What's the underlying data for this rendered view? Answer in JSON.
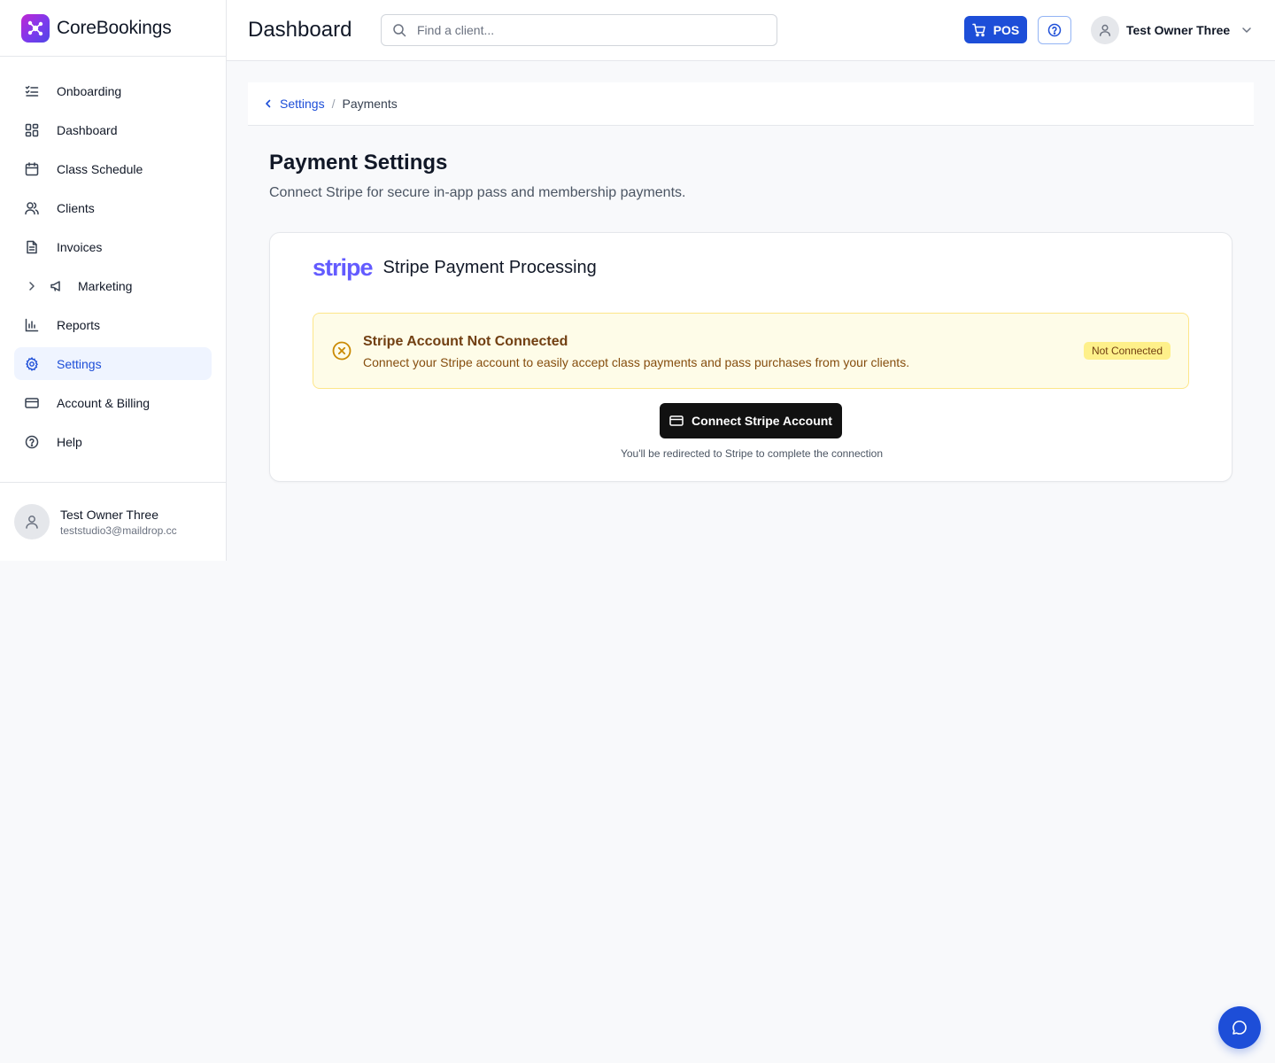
{
  "brand": {
    "name": "CoreBookings",
    "icon": "corebookings-logo-icon"
  },
  "sidebar": {
    "items": [
      {
        "label": "Onboarding",
        "icon": "checklist-icon"
      },
      {
        "label": "Dashboard",
        "icon": "dashboard-grid-icon"
      },
      {
        "label": "Class Schedule",
        "icon": "calendar-icon"
      },
      {
        "label": "Clients",
        "icon": "users-icon"
      },
      {
        "label": "Invoices",
        "icon": "invoice-icon"
      },
      {
        "label": "Marketing",
        "icon": "megaphone-icon"
      },
      {
        "label": "Reports",
        "icon": "bar-chart-icon"
      },
      {
        "label": "Settings",
        "icon": "gear-icon",
        "active": true
      },
      {
        "label": "Account & Billing",
        "icon": "credit-card-icon"
      },
      {
        "label": "Help",
        "icon": "help-circle-icon"
      }
    ],
    "user": {
      "name": "Test Owner Three",
      "email": "teststudio3@maildrop.cc"
    }
  },
  "header": {
    "title": "Dashboard",
    "search_placeholder": "Find a client...",
    "pos_label": "POS",
    "user_name": "Test Owner Three"
  },
  "breadcrumb": {
    "parent": "Settings",
    "separator": "/",
    "current": "Payments"
  },
  "main": {
    "title": "Payment Settings",
    "subtitle": "Connect Stripe for secure in-app pass and membership payments."
  },
  "stripe_card": {
    "logo_text": "stripe",
    "title": "Stripe Payment Processing",
    "alert": {
      "title": "Stripe Account Not Connected",
      "description": "Connect your Stripe account to easily accept class payments and pass purchases from your clients.",
      "badge": "Not Connected"
    },
    "connect_label": "Connect Stripe Account",
    "redirect_note": "You'll be redirected to Stripe to complete the connection"
  },
  "colors": {
    "primary": "#1d4ed8",
    "stripe": "#635bff",
    "warning_bg": "#fefce8",
    "warning_border": "#fde68a",
    "warning_text": "#713f12",
    "background": "#f8f9fb"
  }
}
